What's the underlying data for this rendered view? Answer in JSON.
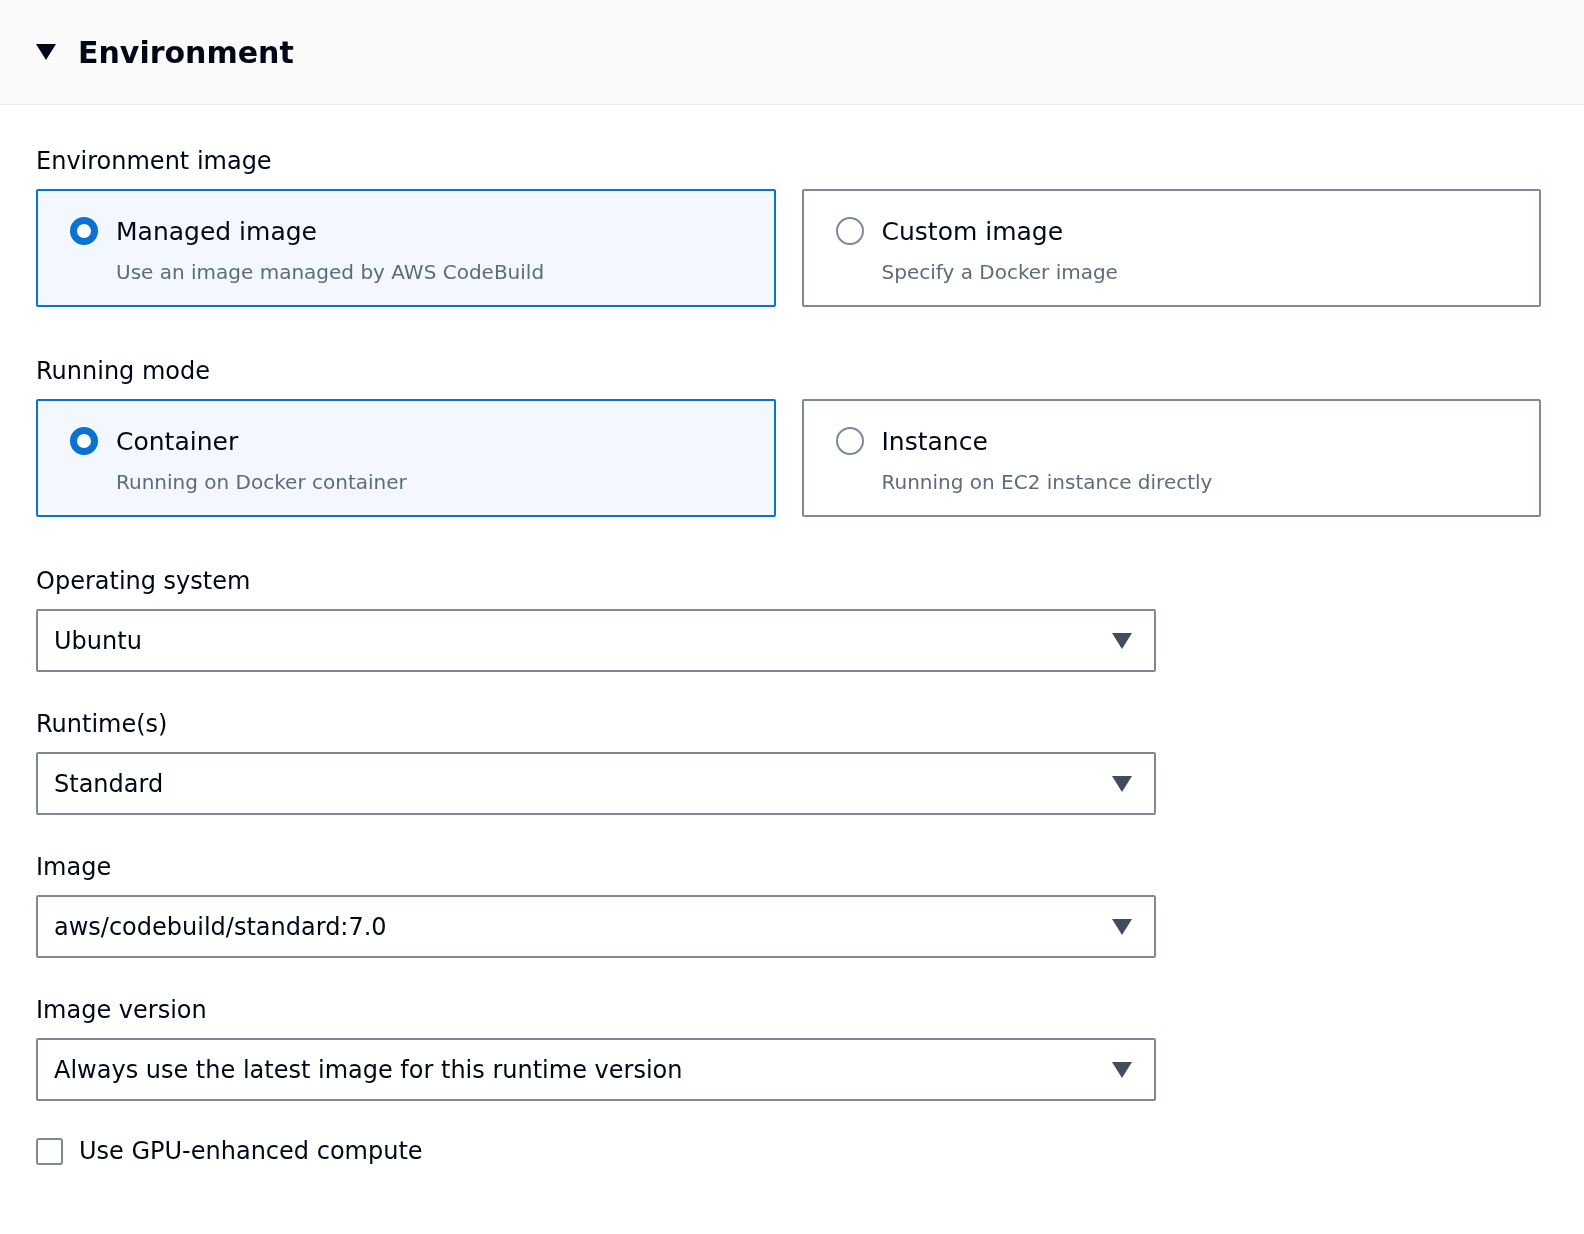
{
  "section": {
    "title": "Environment",
    "expanded": true
  },
  "radio_groups": [
    {
      "label": "Environment image",
      "options": [
        {
          "title": "Managed image",
          "description": "Use an image managed by AWS CodeBuild",
          "selected": true
        },
        {
          "title": "Custom image",
          "description": "Specify a Docker image",
          "selected": false
        }
      ]
    },
    {
      "label": "Running mode",
      "options": [
        {
          "title": "Container",
          "description": "Running on Docker container",
          "selected": true
        },
        {
          "title": "Instance",
          "description": "Running on EC2 instance directly",
          "selected": false
        }
      ]
    }
  ],
  "selects": [
    {
      "label": "Operating system",
      "value": "Ubuntu"
    },
    {
      "label": "Runtime(s)",
      "value": "Standard"
    },
    {
      "label": "Image",
      "value": "aws/codebuild/standard:7.0"
    },
    {
      "label": "Image version",
      "value": "Always use the latest image for this runtime version"
    }
  ],
  "checkbox": {
    "label": "Use GPU-enhanced compute",
    "checked": false
  }
}
